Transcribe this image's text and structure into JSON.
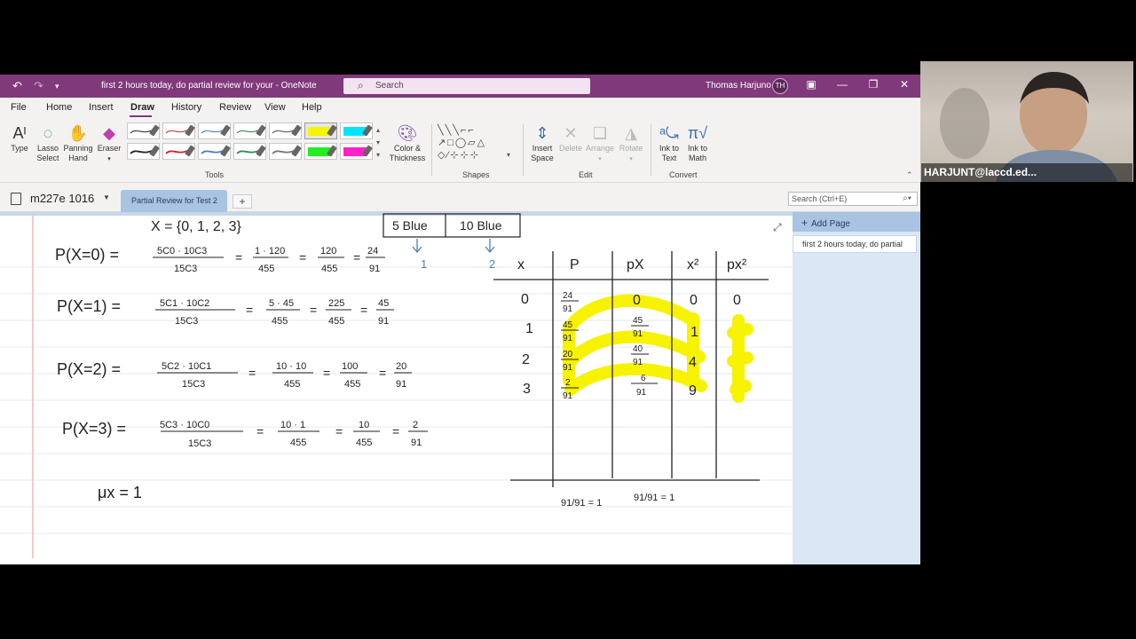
{
  "titlebar": {
    "title": "first 2 hours today,   do partial review for your  -  OneNote",
    "search_placeholder": "Search",
    "user_name": "Thomas Harjuno",
    "user_initials": "TH"
  },
  "menu": [
    "File",
    "Home",
    "Insert",
    "Draw",
    "History",
    "Review",
    "View",
    "Help"
  ],
  "ribbon": {
    "tools": [
      {
        "label1": "Type",
        "label2": ""
      },
      {
        "label1": "Lasso",
        "label2": "Select"
      },
      {
        "label1": "Panning",
        "label2": "Hand"
      },
      {
        "label1": "Eraser",
        "label2": ""
      }
    ],
    "color_thickness": {
      "label1": "Color &",
      "label2": "Thickness"
    },
    "tools_group": "Tools",
    "shapes_group": "Shapes",
    "edit": [
      {
        "label1": "Insert",
        "label2": "Space"
      },
      {
        "label1": "Delete",
        "label2": ""
      },
      {
        "label1": "Arrange",
        "label2": ""
      },
      {
        "label1": "Rotate",
        "label2": ""
      }
    ],
    "edit_group": "Edit",
    "convert": [
      {
        "label1": "Ink to",
        "label2": "Text"
      },
      {
        "label1": "Ink to",
        "label2": "Math"
      }
    ],
    "convert_group": "Convert",
    "pen_colors": [
      "#333333",
      "#c0392b",
      "#4a7fc1",
      "#2e8b57",
      "#555555",
      "#f5f500",
      "#00e5ff",
      "#222222",
      "#d02020",
      "#4a7fc1",
      "#2e8b57",
      "#777777",
      "#22ee22",
      "#ff20c8"
    ]
  },
  "nav": {
    "notebook": "m227e 1016",
    "section": "Partial Review for Test 2",
    "page_search": "Search (Ctrl+E)"
  },
  "pane": {
    "add_page": "Add Page",
    "page": "first 2 hours today,   do partial"
  },
  "notes": {
    "set": "X = {0, 1, 2, 3}",
    "box_left": "5 Blue",
    "box_right": "10 Blue",
    "arrow_left": "1",
    "arrow_right": "2",
    "eq0": {
      "lhs": "P(X=0) =",
      "num": "5C0 · 10C3",
      "den": "15C3",
      "s1n": "1 · 120",
      "s1d": "455",
      "s2n": "120",
      "s2d": "455",
      "s3n": "24",
      "s3d": "91"
    },
    "eq1": {
      "lhs": "P(X=1) =",
      "num": "5C1 · 10C2",
      "den": "15C3",
      "s1n": "5 · 45",
      "s1d": "455",
      "s2n": "225",
      "s2d": "455",
      "s3n": "45",
      "s3d": "91"
    },
    "eq2": {
      "lhs": "P(X=2) =",
      "num": "5C2 · 10C1",
      "den": "15C3",
      "s1n": "10 · 10",
      "s1d": "455",
      "s2n": "100",
      "s2d": "455",
      "s3n": "20",
      "s3d": "91"
    },
    "eq3": {
      "lhs": "P(X=3) =",
      "num": "5C3 · 10C0",
      "den": "15C3",
      "s1n": "10 · 1",
      "s1d": "455",
      "s2n": "10",
      "s2d": "455",
      "s3n": "2",
      "s3d": "91"
    },
    "mean": "μx = 1",
    "table": {
      "headers": [
        "x",
        "P",
        "pX",
        "x²",
        "px²"
      ],
      "rows": [
        {
          "x": "0",
          "pn": "24",
          "pd": "91",
          "pxn": "",
          "pxd": "",
          "px": "0",
          "x2": "0",
          "px2": "0"
        },
        {
          "x": "1",
          "pn": "45",
          "pd": "91",
          "pxn": "45",
          "pxd": "91",
          "px": "",
          "x2": "1",
          "px2": ""
        },
        {
          "x": "2",
          "pn": "20",
          "pd": "91",
          "pxn": "40",
          "pxd": "91",
          "px": "",
          "x2": "4",
          "px2": ""
        },
        {
          "x": "3",
          "pn": "2",
          "pd": "91",
          "pxn": "6",
          "pxd": "91",
          "px": "",
          "x2": "9",
          "px2": ""
        }
      ],
      "sum_p": "91/91 = 1",
      "sum_px": "91/91 = 1"
    }
  },
  "webcam": {
    "label": "HARJUNT@laccd.ed..."
  }
}
